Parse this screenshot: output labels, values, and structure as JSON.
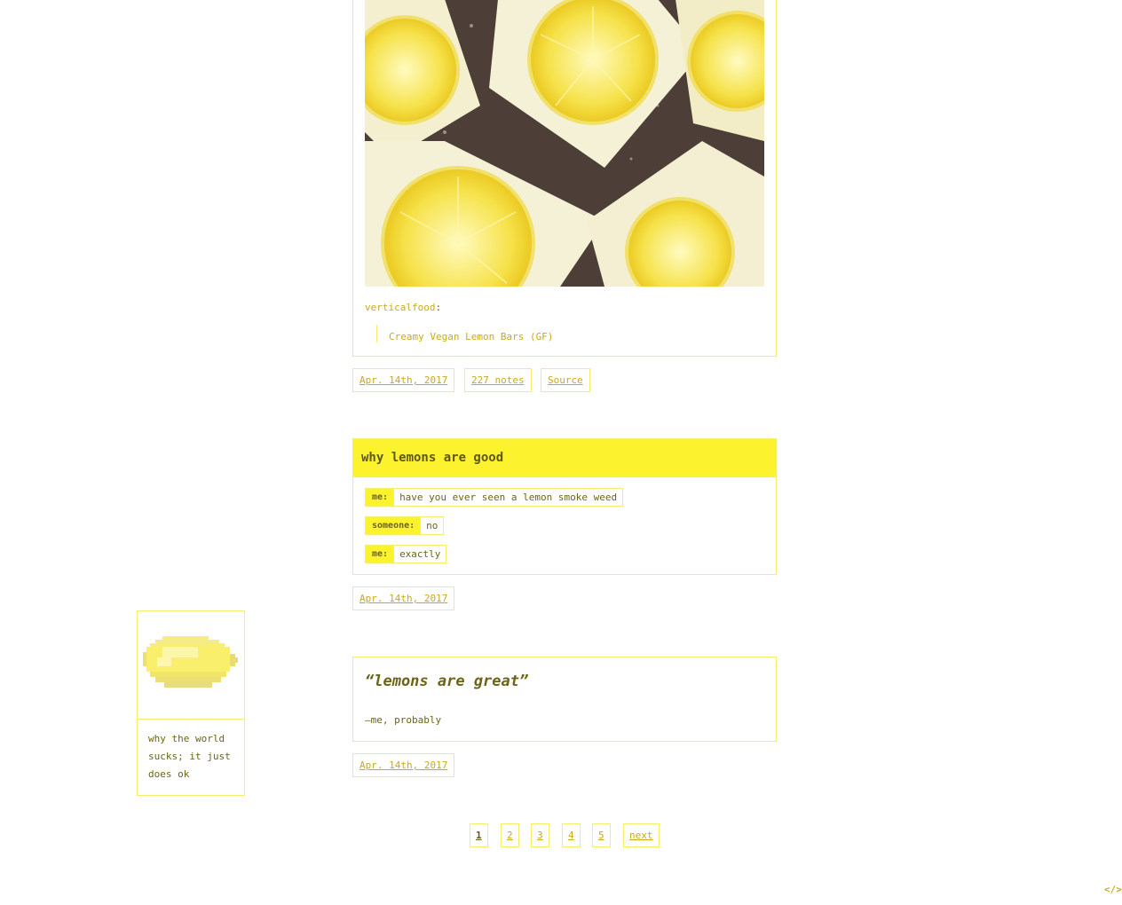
{
  "posts": {
    "photo": {
      "reblog_user": "verticalfood",
      "reblog_colon": ":",
      "caption": "Creamy Vegan Lemon Bars (GF)",
      "date": "Apr. 14th, 2017",
      "notes": "227 notes",
      "source": "Source"
    },
    "chat": {
      "title": "why lemons are good",
      "lines": [
        {
          "speaker": "me:",
          "text": "have you ever seen a lemon smoke weed"
        },
        {
          "speaker": "someone:",
          "text": "no"
        },
        {
          "speaker": "me:",
          "text": "exactly"
        }
      ],
      "date": "Apr. 14th, 2017"
    },
    "quote": {
      "text": "“lemons are great”",
      "source": "—me, probably",
      "date": "Apr. 14th, 2017"
    }
  },
  "sidebar": {
    "description": "why the world sucks; it just does ok"
  },
  "pagination": {
    "pages": [
      "1",
      "2",
      "3",
      "4",
      "5"
    ],
    "current": "1",
    "next": "next"
  },
  "footer": {
    "code_icon": "</>"
  },
  "colors": {
    "accent": "#fdf22e",
    "border": "#f5ee6a",
    "link": "#c9a91a",
    "text": "#6b6418"
  }
}
